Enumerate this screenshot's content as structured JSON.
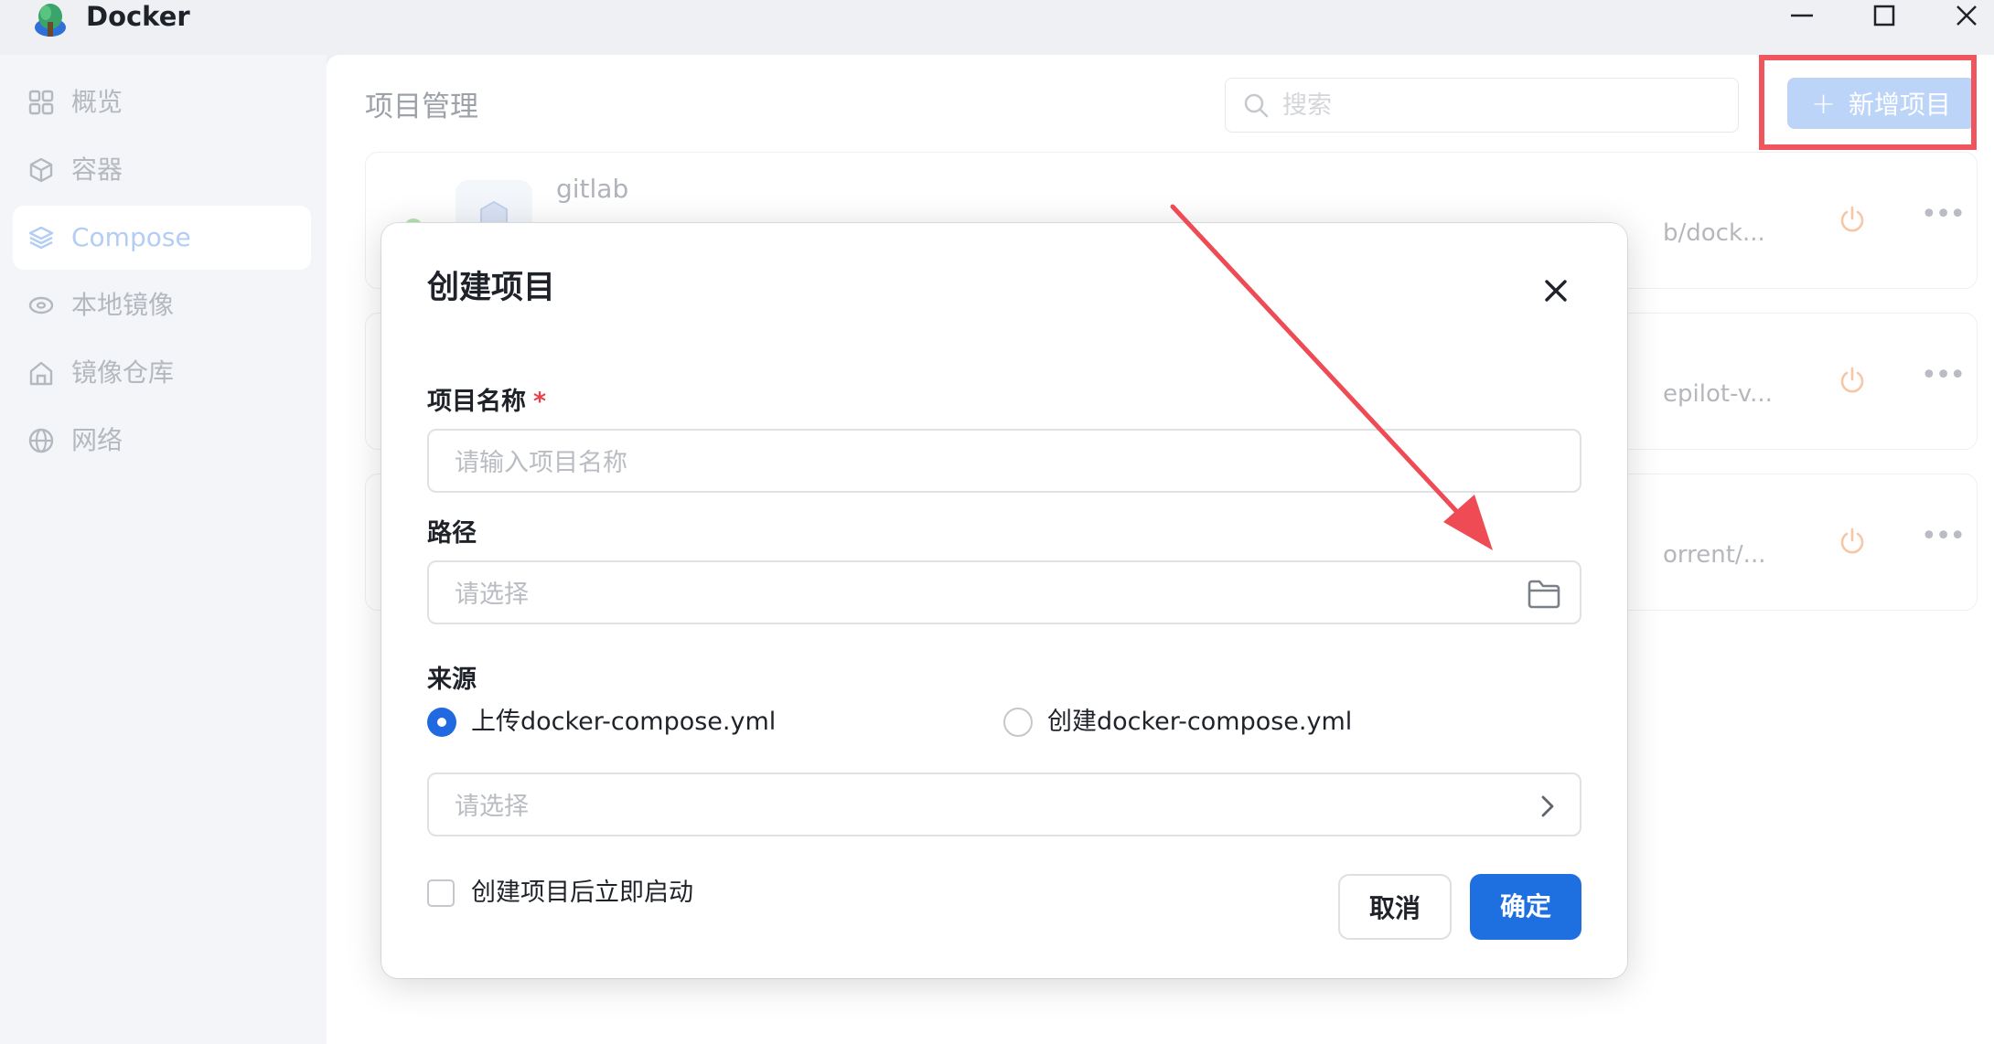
{
  "app": {
    "title": "Docker"
  },
  "sidebar": {
    "items": [
      {
        "label": "概览",
        "icon": "grid-icon",
        "active": false
      },
      {
        "label": "容器",
        "icon": "cube-icon",
        "active": false
      },
      {
        "label": "Compose",
        "icon": "layers-icon",
        "active": true
      },
      {
        "label": "本地镜像",
        "icon": "disk-icon",
        "active": false
      },
      {
        "label": "镜像仓库",
        "icon": "home-icon",
        "active": false
      },
      {
        "label": "网络",
        "icon": "globe-icon",
        "active": false
      }
    ]
  },
  "main": {
    "page_title": "项目管理",
    "search_placeholder": "搜索",
    "add_button_label": "新增项目",
    "projects": [
      {
        "name": "gitlab",
        "path": "b/dock..."
      },
      {
        "name": "",
        "path": "epilot-v..."
      },
      {
        "name": "",
        "path": "orrent/..."
      }
    ]
  },
  "modal": {
    "title": "创建项目",
    "project_name": {
      "label": "项目名称",
      "required_mark": "*",
      "placeholder": "请输入项目名称",
      "value": ""
    },
    "path": {
      "label": "路径",
      "placeholder": "请选择",
      "value": ""
    },
    "source": {
      "label": "来源",
      "options": [
        {
          "label": "上传docker-compose.yml",
          "checked": true
        },
        {
          "label": "创建docker-compose.yml",
          "checked": false
        }
      ],
      "file_placeholder": "请选择"
    },
    "start_after_create": {
      "label": "创建项目后立即启动",
      "checked": false
    },
    "cancel_label": "取消",
    "ok_label": "确定"
  },
  "colors": {
    "primary": "#1e6fe0",
    "annotation_red": "#f0545c",
    "status_green": "#b6e3b0"
  }
}
